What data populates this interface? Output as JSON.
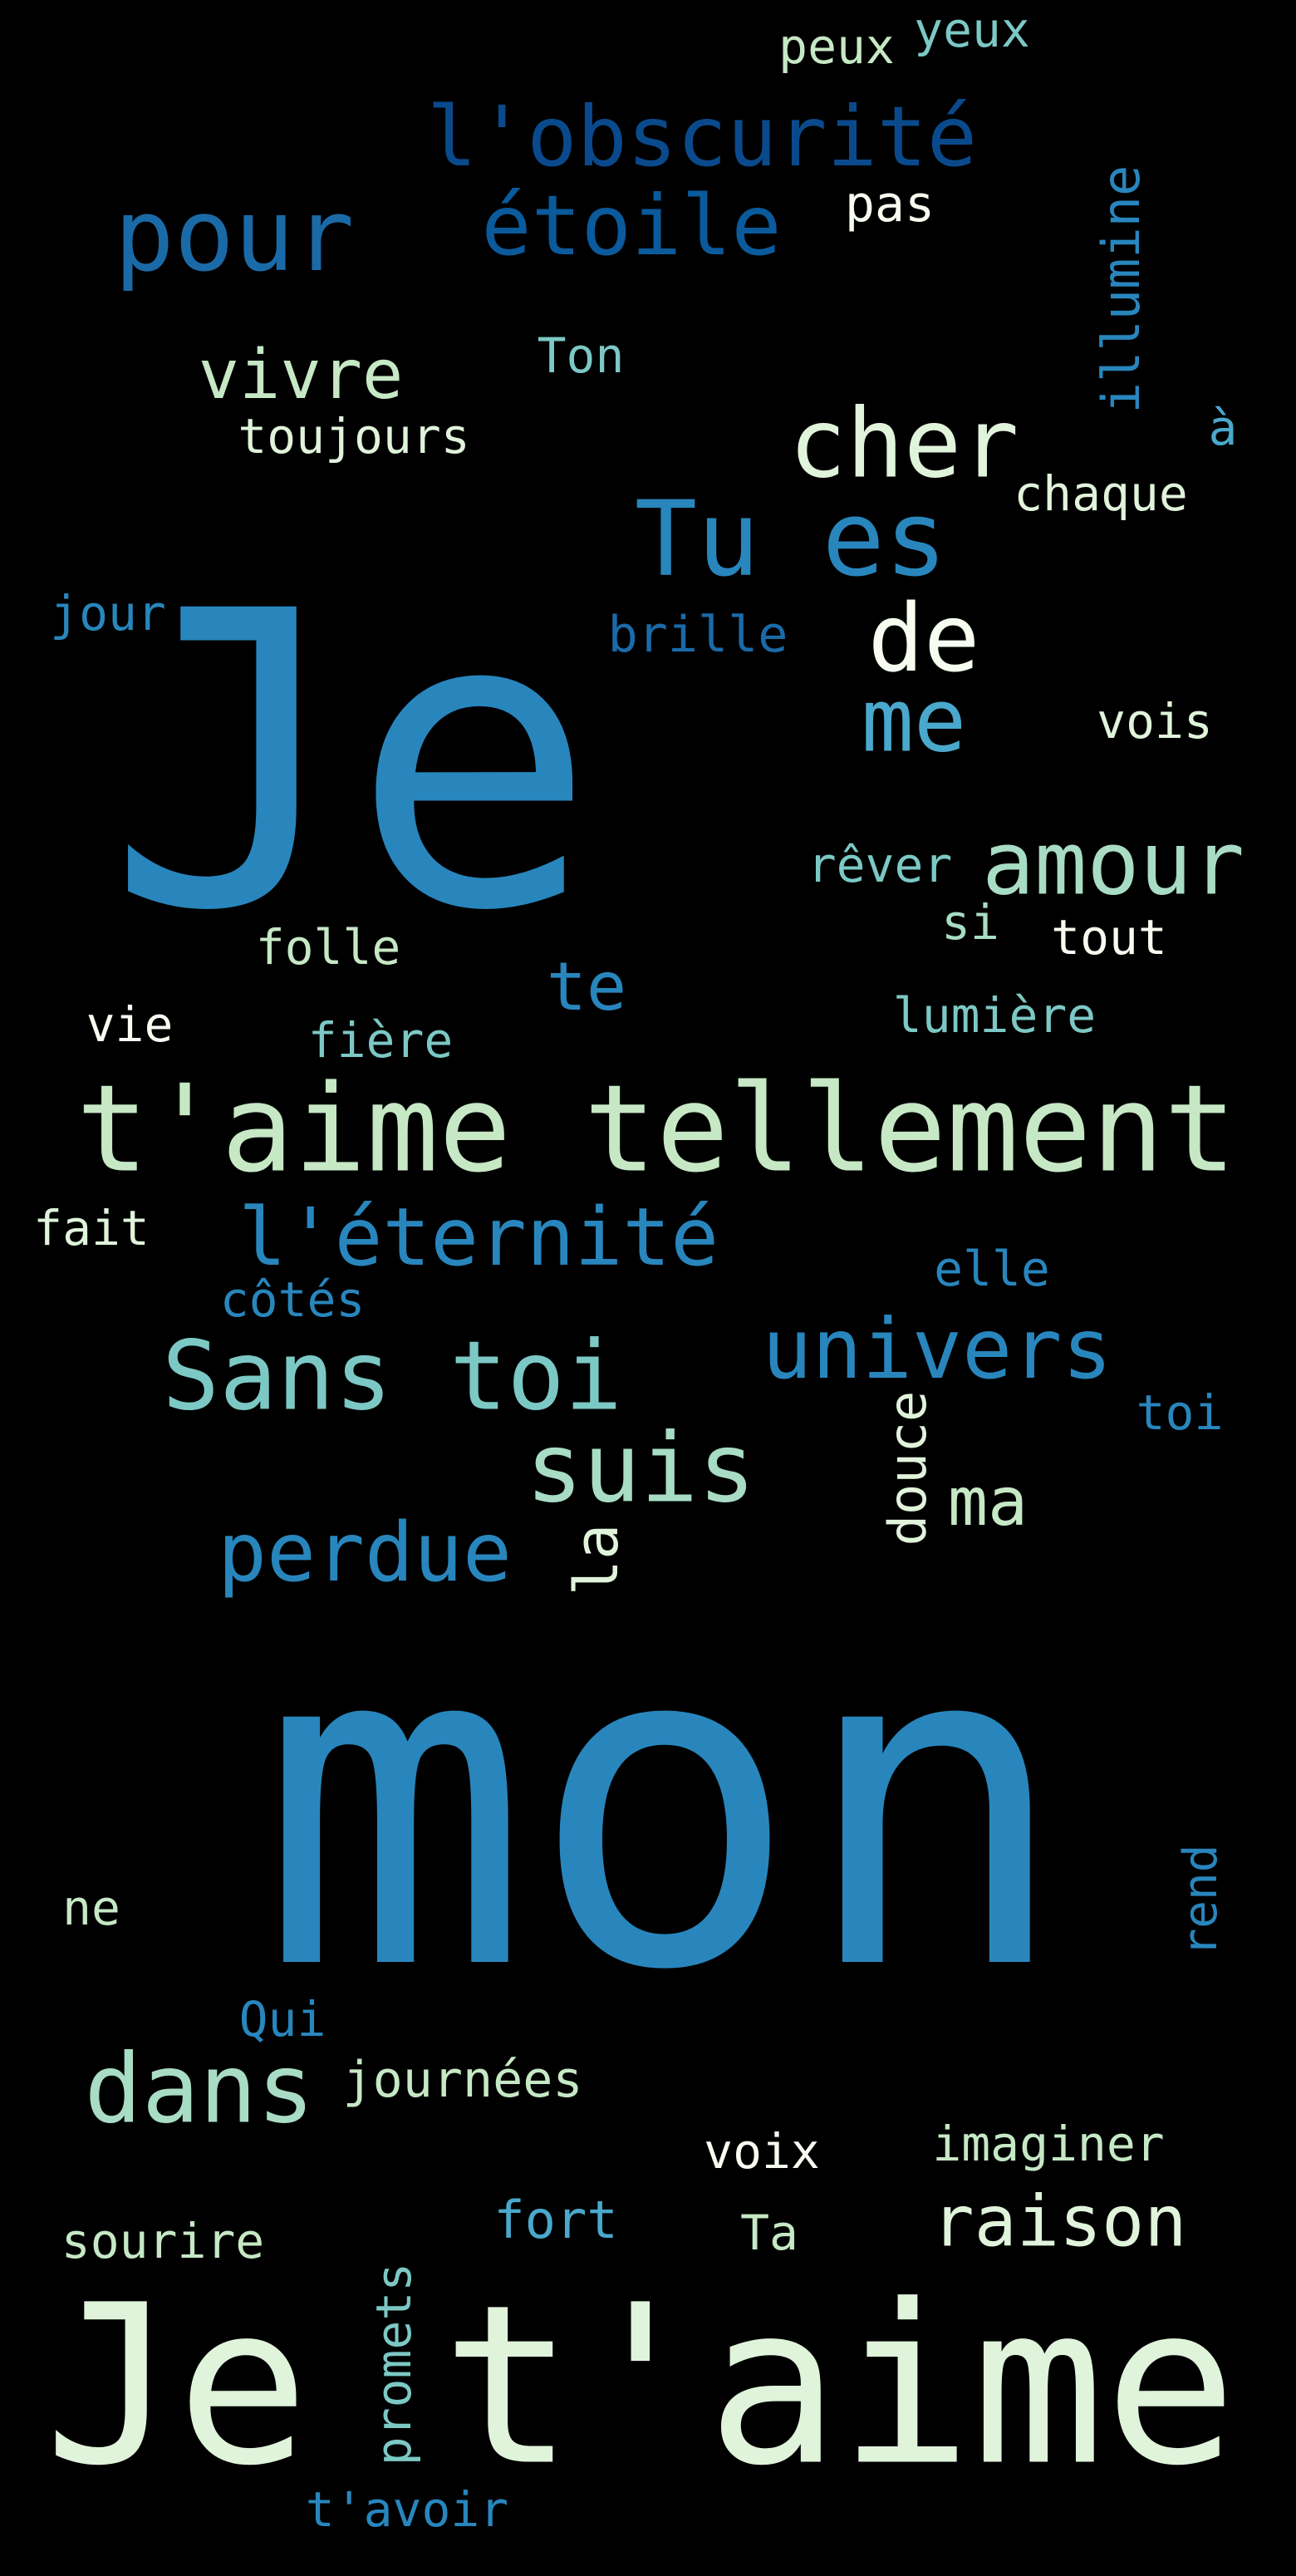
{
  "palette": {
    "background": "#000000",
    "colors": [
      "#2886bd",
      "#0a5a9c",
      "#1b6aa8",
      "#c6e8c5",
      "#9ed8c0",
      "#7cc8c5",
      "#4aa8cc",
      "#e0f3db",
      "#f7fcf0"
    ]
  },
  "words": [
    {
      "text": "mon",
      "color": "#2886bd"
    },
    {
      "text": "Je",
      "color": "#2886bd"
    },
    {
      "text": "Je t'aime",
      "color": "#e0f3db"
    },
    {
      "text": "t'aime tellement",
      "color": "#c6e8c5"
    },
    {
      "text": "Tu es",
      "color": "#2886bd"
    },
    {
      "text": "pour",
      "color": "#1b6aa8"
    },
    {
      "text": "l'obscurité",
      "color": "#0a4a8c"
    },
    {
      "text": "étoile",
      "color": "#0a5a9c"
    },
    {
      "text": "cher",
      "color": "#e0f3db"
    },
    {
      "text": "de",
      "color": "#f7fcf0"
    },
    {
      "text": "me",
      "color": "#4aa8cc"
    },
    {
      "text": "amour",
      "color": "#a8dcc4"
    },
    {
      "text": "vivre",
      "color": "#c6e8c5"
    },
    {
      "text": "Sans toi",
      "color": "#7cc8c5"
    },
    {
      "text": "univers",
      "color": "#2886bd"
    },
    {
      "text": "suis",
      "color": "#a8dcc4"
    },
    {
      "text": "perdue",
      "color": "#2886bd"
    },
    {
      "text": "l'éternité",
      "color": "#2886bd"
    },
    {
      "text": "dans",
      "color": "#a8dcc4"
    },
    {
      "text": "raison",
      "color": "#e0f3db"
    },
    {
      "text": "te",
      "color": "#2886bd"
    },
    {
      "text": "ma",
      "color": "#c6e8c5"
    },
    {
      "text": "la",
      "color": "#e0f3db"
    },
    {
      "text": "illumine",
      "color": "#2886bd"
    },
    {
      "text": "douce",
      "color": "#e0f3db"
    },
    {
      "text": "rend",
      "color": "#2886bd"
    },
    {
      "text": "promets",
      "color": "#7cc8c5"
    },
    {
      "text": "yeux",
      "color": "#7cc8c5"
    },
    {
      "text": "peux",
      "color": "#c6e8c5"
    },
    {
      "text": "pas",
      "color": "#f7fcf0"
    },
    {
      "text": "Ton",
      "color": "#7cc8c5"
    },
    {
      "text": "toujours",
      "color": "#e0f3db"
    },
    {
      "text": "à",
      "color": "#4aa8cc"
    },
    {
      "text": "chaque",
      "color": "#e0f3db"
    },
    {
      "text": "jour",
      "color": "#2886bd"
    },
    {
      "text": "brille",
      "color": "#1b6aa8"
    },
    {
      "text": "vois",
      "color": "#e0f3db"
    },
    {
      "text": "rêver",
      "color": "#7cc8c5"
    },
    {
      "text": "si",
      "color": "#a8dcc4"
    },
    {
      "text": "tout",
      "color": "#f7fcf0"
    },
    {
      "text": "folle",
      "color": "#c6e8c5"
    },
    {
      "text": "vie",
      "color": "#f7fcf0"
    },
    {
      "text": "fière",
      "color": "#7cc8c5"
    },
    {
      "text": "lumière",
      "color": "#7cc8c5"
    },
    {
      "text": "fait",
      "color": "#e0f3db"
    },
    {
      "text": "elle",
      "color": "#2886bd"
    },
    {
      "text": "côtés",
      "color": "#2886bd"
    },
    {
      "text": "toi",
      "color": "#2886bd"
    },
    {
      "text": "ne",
      "color": "#c6e8c5"
    },
    {
      "text": "Qui",
      "color": "#2886bd"
    },
    {
      "text": "journées",
      "color": "#c6e8c5"
    },
    {
      "text": "voix",
      "color": "#f7fcf0"
    },
    {
      "text": "imaginer",
      "color": "#c6e8c5"
    },
    {
      "text": "sourire",
      "color": "#c6e8c5"
    },
    {
      "text": "fort",
      "color": "#4aa8cc"
    },
    {
      "text": "Ta",
      "color": "#c6e8c5"
    },
    {
      "text": "t'avoir",
      "color": "#2886bd"
    }
  ]
}
